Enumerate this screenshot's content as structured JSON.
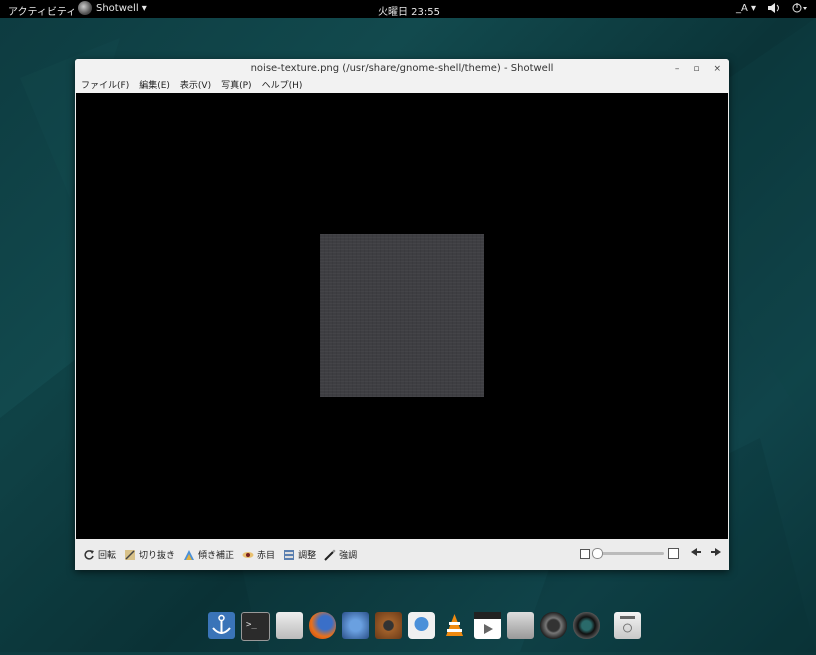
{
  "topbar": {
    "activities": "アクティビティ",
    "app_name": "Shotwell ▾",
    "clock": "火曜日 23:55",
    "input_method": "_A ▾",
    "volume_icon": "speaker-icon",
    "power_icon": "power-icon"
  },
  "window": {
    "title": "noise-texture.png (/usr/share/gnome-shell/theme) - Shotwell",
    "controls": {
      "minimize": "–",
      "maximize": "▫",
      "close": "×"
    },
    "menu": [
      "ファイル(F)",
      "編集(E)",
      "表示(V)",
      "写真(P)",
      "ヘルプ(H)"
    ],
    "toolbar": {
      "rotate": "回転",
      "crop": "切り抜き",
      "straighten": "傾き補正",
      "redeye": "赤目",
      "adjust": "調整",
      "enhance": "強調"
    },
    "zoom_level": 0
  },
  "dock": [
    "anchor-icon",
    "terminal-icon",
    "files-icon",
    "firefox-icon",
    "mail-icon",
    "speaker-icon",
    "chat-icon",
    "vlc-icon",
    "video-icon",
    "mixer-icon",
    "camera-icon",
    "webcam-icon",
    "trash-icon"
  ]
}
